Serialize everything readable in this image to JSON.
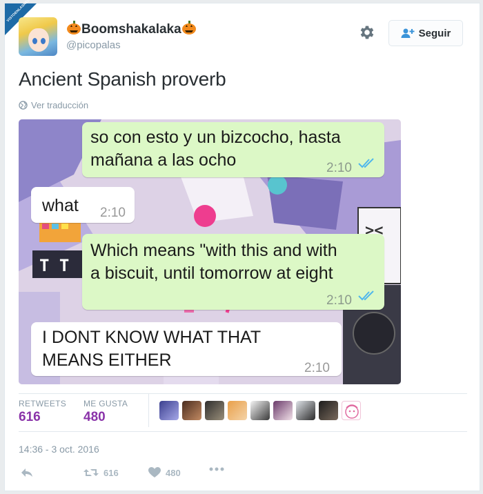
{
  "watermark": "VISTOENLASREDES.COM",
  "user": {
    "display_name": "Boomshakalaka",
    "handle": "@picopalas"
  },
  "follow_label": "Seguir",
  "tweet_text": "Ancient Spanish proverb",
  "translate_label": "Ver traducción",
  "media": {
    "messages": [
      {
        "dir": "out",
        "text": "so con esto y un bizcocho, hasta\nmañana a las ocho",
        "time": "2:10"
      },
      {
        "dir": "in",
        "text": "what",
        "time": "2:10"
      },
      {
        "dir": "out",
        "text": "Which means \"with this and with\na biscuit, until tomorrow at eight",
        "time": "2:10"
      },
      {
        "dir": "in",
        "text": "I DONT KNOW WHAT THAT\nMEANS EITHER",
        "time": "2:10"
      }
    ]
  },
  "stats": {
    "retweets_label": "RETWEETS",
    "retweets_value": "616",
    "likes_label": "ME GUSTA",
    "likes_value": "480"
  },
  "timestamp": "14:36 - 3 oct. 2016",
  "actions": {
    "retweet_count": "616",
    "like_count": "480"
  },
  "colors": {
    "accent": "#8a33a9",
    "follow_icon": "#3b94d9",
    "bubble_out": "#dcf8c6"
  }
}
